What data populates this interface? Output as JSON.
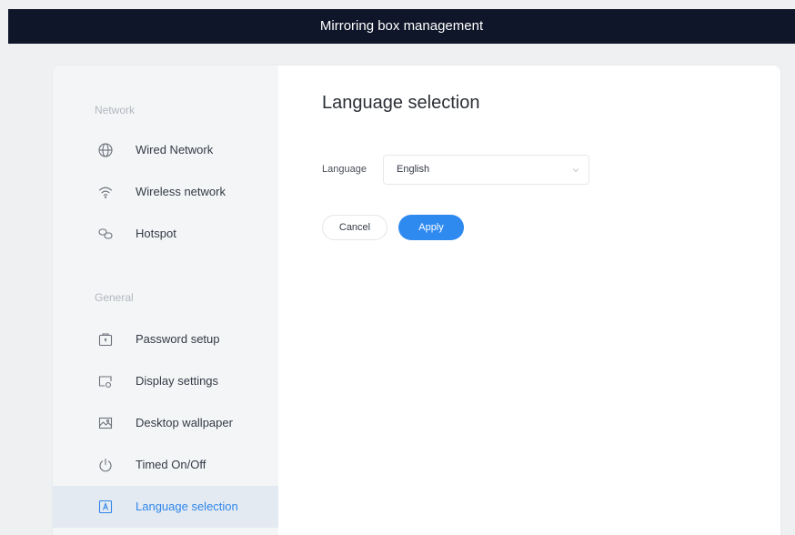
{
  "app": {
    "title": "Mirroring box management"
  },
  "sidebar": {
    "sections": [
      {
        "title": "Network",
        "items": [
          {
            "label": "Wired Network",
            "icon": "globe-icon"
          },
          {
            "label": "Wireless network",
            "icon": "wifi-icon"
          },
          {
            "label": "Hotspot",
            "icon": "hotspot-link-icon"
          }
        ]
      },
      {
        "title": "General",
        "items": [
          {
            "label": "Password setup",
            "icon": "password-lock-icon"
          },
          {
            "label": "Display settings",
            "icon": "display-icon"
          },
          {
            "label": "Desktop wallpaper",
            "icon": "wallpaper-image-icon"
          },
          {
            "label": "Timed On/Off",
            "icon": "power-icon"
          },
          {
            "label": "Language selection",
            "icon": "language-icon",
            "active": true
          }
        ]
      }
    ]
  },
  "main": {
    "title": "Language selection",
    "language_label": "Language",
    "language_value": "English",
    "cancel_label": "Cancel",
    "apply_label": "Apply"
  },
  "colors": {
    "titlebar": "#0f1629",
    "accent": "#2f8af0",
    "sidebar_bg": "#f4f5f7",
    "active_item_bg": "#e4eaf2"
  }
}
